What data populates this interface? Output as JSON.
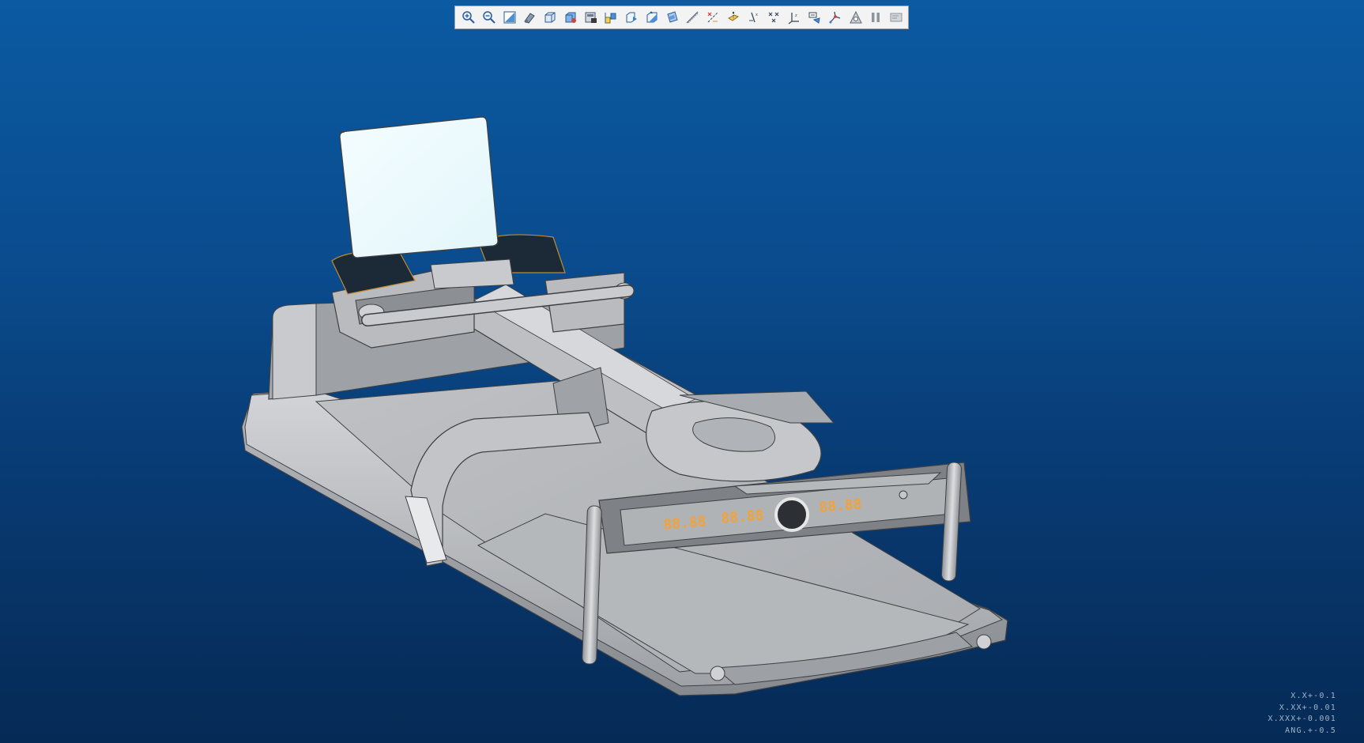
{
  "toolbar": {
    "icons": [
      "zoom-in-icon",
      "zoom-out-icon",
      "refit-icon",
      "reorient-icon",
      "saved-views-icon",
      "display-style-icon",
      "view-manager-icon",
      "layers-icon",
      "perspective-icon",
      "section-icon",
      "spin-center-icon",
      "plane-display-icon",
      "axis-display-icon",
      "point-display-icon",
      "csys-display-icon",
      "point-tag-icon",
      "csys-tag-icon",
      "annotation-display-icon",
      "repaint-icon",
      "appearance-icon",
      "pause-icon",
      "more-icon"
    ]
  },
  "console": {
    "display_left": "88.88",
    "display_mid": "88.88",
    "display_right": "88.88"
  },
  "tolerance": {
    "line1": "X.X+-0.1",
    "line2": "X.XX+-0.01",
    "line3": "X.XXX+-0.001",
    "line4": "ANG.+-0.5"
  }
}
